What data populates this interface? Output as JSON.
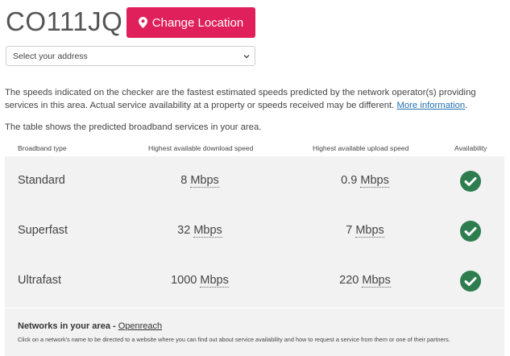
{
  "header": {
    "postcode": "CO111JQ",
    "change_location_label": "Change Location"
  },
  "address_select": {
    "selected": "Select your address"
  },
  "info": {
    "paragraph1": "The speeds indicated on the checker are the fastest estimated speeds predicted by the network operator(s) providing services in this area. Actual service availability at a property or speeds received may be different.",
    "more_info_link": "More information",
    "paragraph2": "The table shows the predicted broadband services in your area."
  },
  "table": {
    "columns": [
      "Broadband type",
      "Highest available download speed",
      "Highest available upload speed",
      "Availability"
    ],
    "rows": [
      {
        "type": "Standard",
        "download": "8",
        "upload": "0.9",
        "unit": "Mbps",
        "available": true
      },
      {
        "type": "Superfast",
        "download": "32",
        "upload": "7",
        "unit": "Mbps",
        "available": true
      },
      {
        "type": "Ultrafast",
        "download": "1000",
        "upload": "220",
        "unit": "Mbps",
        "available": true
      }
    ]
  },
  "networks": {
    "title": "Networks in your area - ",
    "link": "Openreach",
    "description": "Click on a network's name to be directed to a website where you can find out about service availability and how to request a service from them or one of their partners."
  },
  "colors": {
    "accent": "#e0205a",
    "check": "#2e7d4f",
    "row_bg": "#f2f2f2",
    "link": "#1f6fb5"
  },
  "icons": {
    "location": "map-pin-icon",
    "dropdown": "chevron-down-icon",
    "availability": "check-circle-icon"
  }
}
